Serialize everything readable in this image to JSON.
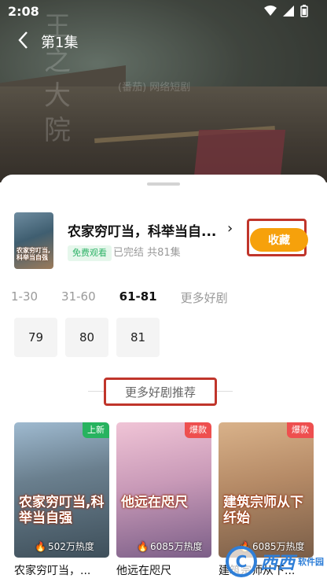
{
  "status_bar": {
    "time": "2:08"
  },
  "toolbar": {
    "title": "第1集"
  },
  "video_watermark": {
    "big_text": "王\n之\n大\n院",
    "line_text": "(番茄) 网络短剧"
  },
  "drama": {
    "title": "农家穷叮当，科举当自...",
    "badge": "免费观看",
    "meta": "已完结 共81集",
    "cover_text": "农家穷叮当,科举当自强",
    "favorite_label": "收藏"
  },
  "episode_tabs": [
    {
      "label": "1-30",
      "active": false
    },
    {
      "label": "31-60",
      "active": false
    },
    {
      "label": "61-81",
      "active": true
    },
    {
      "label": "更多好剧",
      "active": false
    }
  ],
  "episodes": [
    "79",
    "80",
    "81"
  ],
  "recommend": {
    "header": "更多好剧推荐",
    "items": [
      {
        "name": "农家穷叮当，...",
        "tag": "上新",
        "poster_title": "农家穷叮当,科举当自强",
        "heat": "502万热度"
      },
      {
        "name": "他远在咫尺",
        "tag": "爆款",
        "poster_title": "他远在咫尺",
        "heat": "6085万热度"
      },
      {
        "name": "建筑宗师从下...",
        "tag": "爆款",
        "poster_title": "建筑宗师从下纤始",
        "heat": "6085万热度"
      }
    ]
  },
  "site_watermark": {
    "logo_text": "C",
    "text1": "西西",
    "text2": "软件园"
  },
  "colors": {
    "favorite": "#f6a10b",
    "highlight_box": "#c0352b",
    "new_tag": "#27b35f",
    "hot_tag": "#ee4f4f",
    "free_badge_text": "#2fb368"
  }
}
